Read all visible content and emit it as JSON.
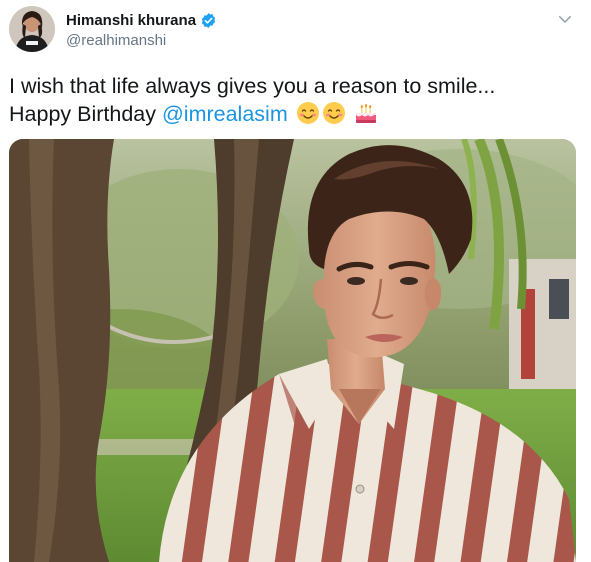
{
  "author": {
    "display_name": "Himanshi khurana",
    "handle": "@realhimanshi",
    "verified": true
  },
  "tweet": {
    "line1": "I wish that life always gives you a reason to smile...",
    "line2_prefix": "Happy Birthday ",
    "mention": "@imrealasim",
    "emojis": [
      "smiling-face-emoji",
      "smiling-face-emoji",
      "birthday-cake-emoji"
    ]
  },
  "icons": {
    "verified": "verified-badge-icon",
    "more": "chevron-down-icon"
  },
  "colors": {
    "text": "#14171a",
    "secondary": "#657786",
    "link": "#1b95e0",
    "verified": "#1da1f2"
  }
}
